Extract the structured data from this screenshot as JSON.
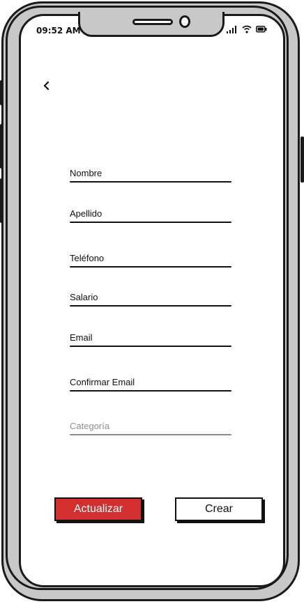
{
  "status_bar": {
    "time": "09:52 AM",
    "icons": [
      "signal-icon",
      "wifi-icon",
      "battery-icon"
    ]
  },
  "nav": {
    "back_icon": "chevron-left-icon"
  },
  "form": {
    "fields": [
      {
        "label": "Nombre"
      },
      {
        "label": "Apellido"
      },
      {
        "label": "Teléfono"
      },
      {
        "label": "Salario"
      },
      {
        "label": "Email"
      },
      {
        "label": "Confirmar Email"
      },
      {
        "placeholder": "Categoría"
      }
    ]
  },
  "actions": {
    "update_label": "Actualizar",
    "create_label": "Crear"
  },
  "colors": {
    "primary": "#d32f2f",
    "frame": "#c8c8c8",
    "ink": "#111111"
  }
}
